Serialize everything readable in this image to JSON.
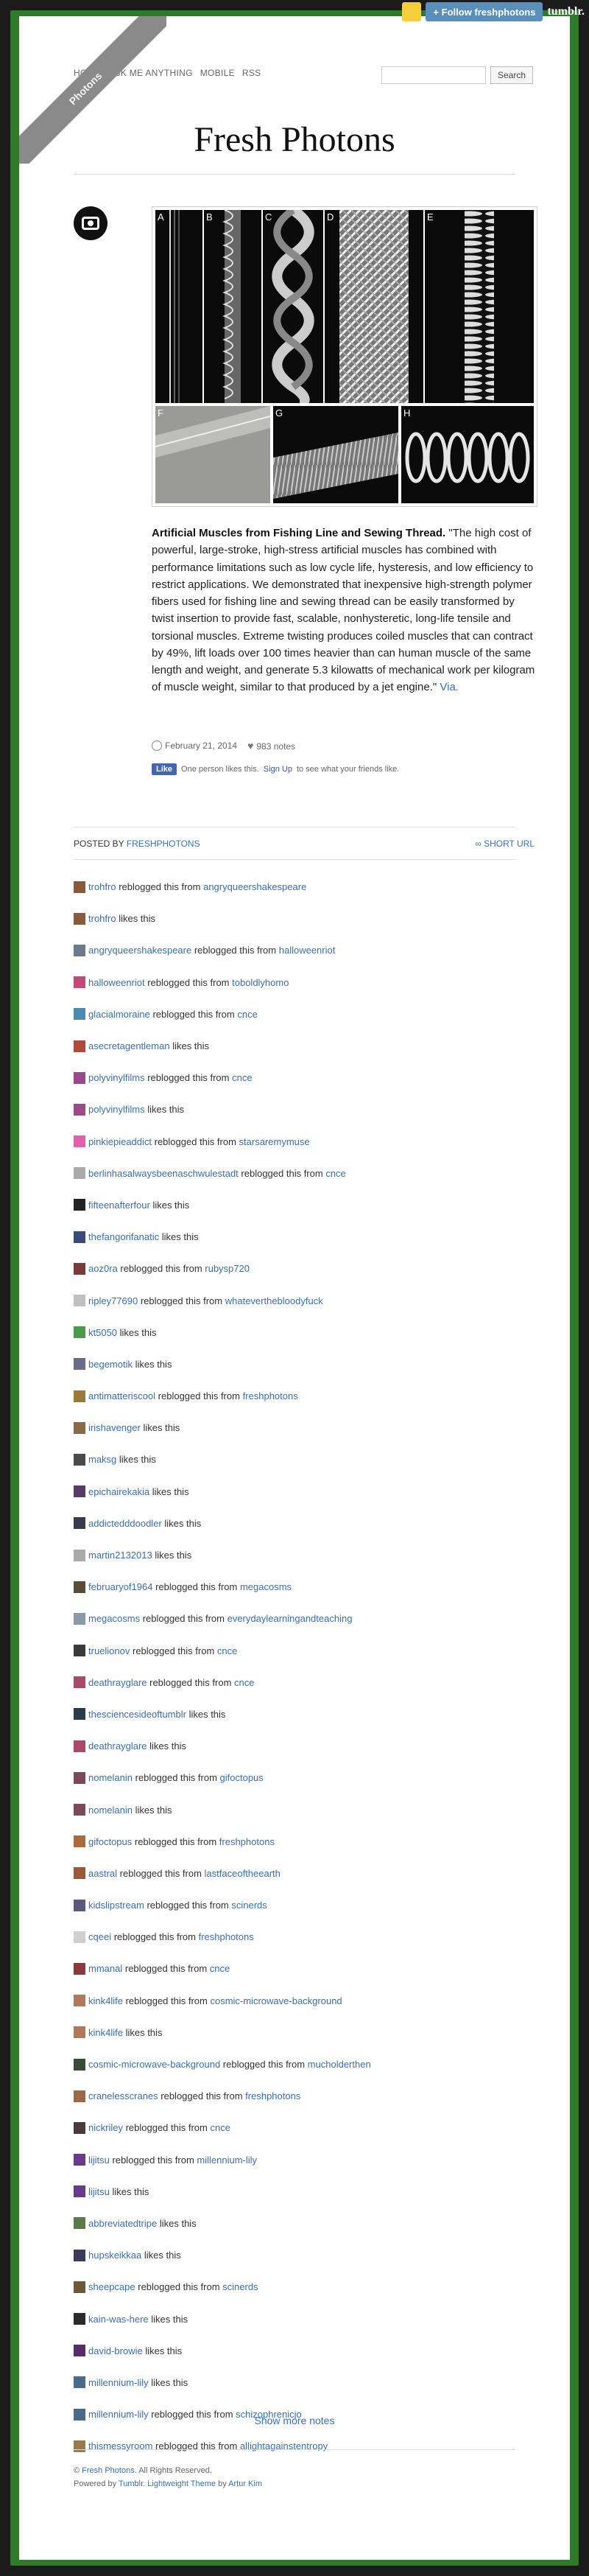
{
  "tumblr_bar": {
    "follow_label": "+ Follow freshphotons",
    "brand": "tumblr."
  },
  "ribbon": {
    "text": "Photons"
  },
  "nav": [
    "HOME",
    "ASK ME ANYTHING",
    "MOBILE",
    "RSS"
  ],
  "search": {
    "placeholder": "",
    "button_label": "Search"
  },
  "blog_title": "Fresh Photons",
  "photo_panels": [
    "A",
    "B",
    "C",
    "D",
    "E",
    "F",
    "G",
    "H"
  ],
  "caption": {
    "bold": "Artificial Muscles from Fishing Line and Sewing Thread.",
    "body": " \"The high cost of powerful, large-stroke, high-stress artificial muscles has combined with performance limitations such as low cycle life, hysteresis, and low efficiency to restrict applications. We demonstrated that inexpensive high-strength polymer fibers used for fishing line and sewing thread can be easily transformed by twist insertion to provide fast, scalable, nonhysteretic, long-life tensile and torsional muscles. Extreme twisting produces coiled muscles that can contract by 49%, lift loads over 100 times heavier than can human muscle of the same length and weight, and generate 5.3 kilowatts of mechanical work per kilogram of muscle weight, similar to that produced by a jet engine.\" ",
    "via": "Via."
  },
  "meta": {
    "date": "February 21, 2014",
    "notes": "983 notes"
  },
  "facebook": {
    "like_label": "Like",
    "text_before": "One person likes this.",
    "signup_link": "Sign Up",
    "text_after": "to see what your friends like."
  },
  "posted_by": {
    "label": "POSTED BY",
    "user": "FRESHPHOTONS",
    "short_url": "∞ SHORT URL"
  },
  "notes": [
    {
      "user": "trohfro",
      "action": "reblogged this from",
      "src": "angryqueershakespeare",
      "color": "#8a5a3c"
    },
    {
      "user": "trohfro",
      "action": "likes this",
      "src": "",
      "color": "#8a5a3c"
    },
    {
      "user": "angryqueershakespeare",
      "action": "reblogged this from",
      "src": "halloweenriot",
      "color": "#6b7b8a"
    },
    {
      "user": "halloweenriot",
      "action": "reblogged this from",
      "src": "toboldlyhomo",
      "color": "#c24a7a"
    },
    {
      "user": "glacialmoraine",
      "action": "reblogged this from",
      "src": "cnce",
      "color": "#4a8ab0"
    },
    {
      "user": "asecretagentleman",
      "action": "likes this",
      "src": "",
      "color": "#b04a3a"
    },
    {
      "user": "polyvinylfilms",
      "action": "reblogged this from",
      "src": "cnce",
      "color": "#9a4a8a"
    },
    {
      "user": "polyvinylfilms",
      "action": "likes this",
      "src": "",
      "color": "#9a4a8a"
    },
    {
      "user": "pinkiepieaddict",
      "action": "reblogged this from",
      "src": "starsaremymuse",
      "color": "#e060b0"
    },
    {
      "user": "berlinhasalwaysbeenaschwulestadt",
      "action": "reblogged this from",
      "src": "cnce",
      "color": "#aaaaaa"
    },
    {
      "user": "fifteenafterfour",
      "action": "likes this",
      "src": "",
      "color": "#222222"
    },
    {
      "user": "thefangorifanatic",
      "action": "likes this",
      "src": "",
      "color": "#3a4a7a"
    },
    {
      "user": "aoz0ra",
      "action": "reblogged this from",
      "src": "rubysp720",
      "color": "#7a3a3a"
    },
    {
      "user": "ripley77690",
      "action": "reblogged this from",
      "src": "whateverthebloodyfuck",
      "color": "#c0c0c0"
    },
    {
      "user": "kt5050",
      "action": "likes this",
      "src": "",
      "color": "#4a9a4a"
    },
    {
      "user": "begemotik",
      "action": "likes this",
      "src": "",
      "color": "#6a6a8a"
    },
    {
      "user": "antimatteriscool",
      "action": "reblogged this from",
      "src": "freshphotons",
      "color": "#9a7a3a"
    },
    {
      "user": "irishavenger",
      "action": "likes this",
      "src": "",
      "color": "#8a6a4a"
    },
    {
      "user": "maksg",
      "action": "likes this",
      "src": "",
      "color": "#4a4a4a"
    },
    {
      "user": "epichairekakia",
      "action": "likes this",
      "src": "",
      "color": "#5a3a6a"
    },
    {
      "user": "addictedddoodler",
      "action": "likes this",
      "src": "",
      "color": "#3a3a4a"
    },
    {
      "user": "martin2132013",
      "action": "likes this",
      "src": "",
      "color": "#aaaaaa"
    },
    {
      "user": "februaryof1964",
      "action": "reblogged this from",
      "src": "megacosms",
      "color": "#5a4a3a"
    },
    {
      "user": "megacosms",
      "action": "reblogged this from",
      "src": "everydaylearningandteaching",
      "color": "#8a9aaa"
    },
    {
      "user": "truelionov",
      "action": "reblogged this from",
      "src": "cnce",
      "color": "#3a3a3a"
    },
    {
      "user": "deathrayglare",
      "action": "reblogged this from",
      "src": "cnce",
      "color": "#aa4a6a"
    },
    {
      "user": "thesciencesideoftumblr",
      "action": "likes this",
      "src": "",
      "color": "#2a3a4a"
    },
    {
      "user": "deathrayglare",
      "action": "likes this",
      "src": "",
      "color": "#aa4a6a"
    },
    {
      "user": "nomelanin",
      "action": "reblogged this from",
      "src": "gifoctopus",
      "color": "#7a4a5a"
    },
    {
      "user": "nomelanin",
      "action": "likes this",
      "src": "",
      "color": "#7a4a5a"
    },
    {
      "user": "gifoctopus",
      "action": "reblogged this from",
      "src": "freshphotons",
      "color": "#aa6a3a"
    },
    {
      "user": "aastral",
      "action": "reblogged this from",
      "src": "lastfaceoftheearth",
      "color": "#9a5a3a"
    },
    {
      "user": "kidslipstream",
      "action": "reblogged this from",
      "src": "scinerds",
      "color": "#5a5a7a"
    },
    {
      "user": "cqeei",
      "action": "reblogged this from",
      "src": "freshphotons",
      "color": "#cfcfcf"
    },
    {
      "user": "mmanal",
      "action": "reblogged this from",
      "src": "cnce",
      "color": "#8a3a3a"
    },
    {
      "user": "kink4life",
      "action": "reblogged this from",
      "src": "cosmic-microwave-background",
      "color": "#b07a5a"
    },
    {
      "user": "kink4life",
      "action": "likes this",
      "src": "",
      "color": "#b07a5a"
    },
    {
      "user": "cosmic-microwave-background",
      "action": "reblogged this from",
      "src": "mucholderthen",
      "color": "#3a4a3a"
    },
    {
      "user": "cranelesscranes",
      "action": "reblogged this from",
      "src": "freshphotons",
      "color": "#9a6a4a"
    },
    {
      "user": "nickriley",
      "action": "reblogged this from",
      "src": "cnce",
      "color": "#4a3a3a"
    },
    {
      "user": "lijitsu",
      "action": "reblogged this from",
      "src": "millennium-lily",
      "color": "#6a3a8a"
    },
    {
      "user": "lijitsu",
      "action": "likes this",
      "src": "",
      "color": "#6a3a8a"
    },
    {
      "user": "abbreviatedtripe",
      "action": "likes this",
      "src": "",
      "color": "#5a7a4a"
    },
    {
      "user": "hupskeikkaa",
      "action": "likes this",
      "src": "",
      "color": "#3a3a5a"
    },
    {
      "user": "sheepcape",
      "action": "reblogged this from",
      "src": "scinerds",
      "color": "#6a5a3a"
    },
    {
      "user": "kain-was-here",
      "action": "likes this",
      "src": "",
      "color": "#2a2a2a"
    },
    {
      "user": "david-browie",
      "action": "likes this",
      "src": "",
      "color": "#5a2a6a"
    },
    {
      "user": "millennium-lily",
      "action": "likes this",
      "src": "",
      "color": "#4a6a8a"
    },
    {
      "user": "millennium-lily",
      "action": "reblogged this from",
      "src": "schizophrenicjo",
      "color": "#4a6a8a"
    },
    {
      "user": "thismessyroom",
      "action": "reblogged this from",
      "src": "allightagainstentropy",
      "color": "#9a7a4a"
    }
  ],
  "show_more": "Show more notes",
  "footer": {
    "line1_prefix": "© ",
    "line1_link": "Fresh Photons",
    "line1_suffix": ". All Rights Reserved.",
    "line2_prefix": "Powered by ",
    "tumblr_link": "Tumblr",
    "line2_mid": ". ",
    "theme_link": "Lightweight Theme",
    "line2_by": " by ",
    "author_link": "Artur Kim"
  }
}
